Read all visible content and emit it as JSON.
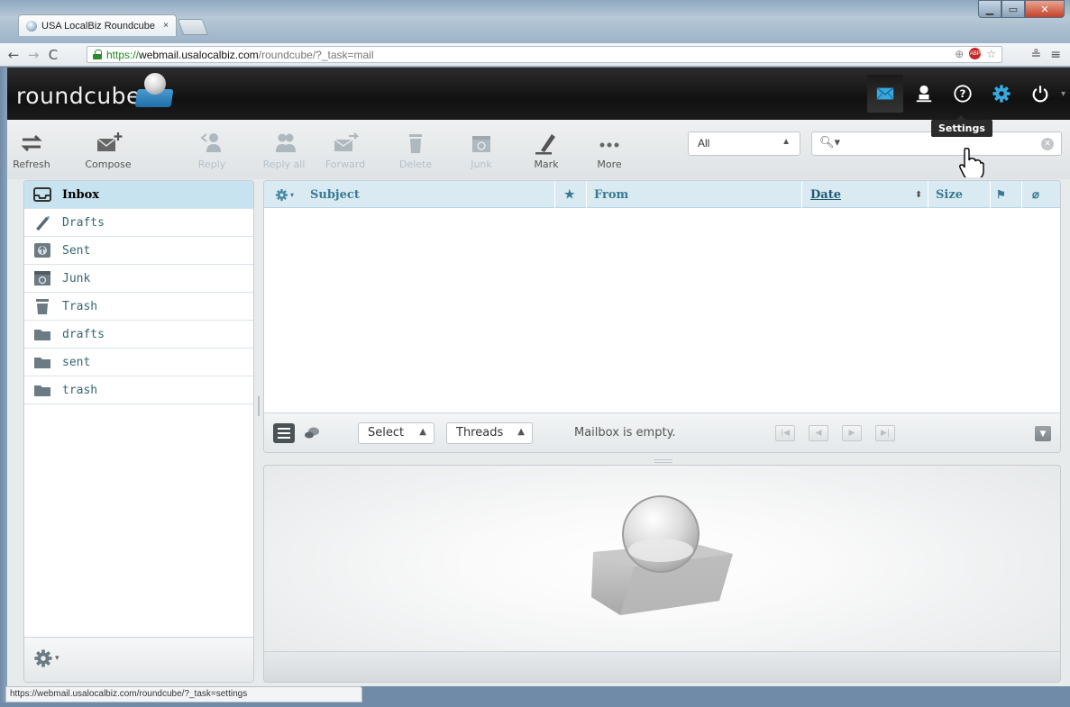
{
  "browser": {
    "tab_title": "USA LocalBiz Roundcube",
    "tab_close": "×",
    "url_scheme": "https://",
    "url_host": "webmail.usalocalbiz.com",
    "url_path": "/roundcube/?_task=mail",
    "status_url": "https://webmail.usalocalbiz.com/roundcube/?_task=settings"
  },
  "header": {
    "logo_text": "roundcube",
    "tooltip": "Settings",
    "nav": [
      {
        "name": "mail",
        "icon": "envelope-icon",
        "active": true
      },
      {
        "name": "contacts",
        "icon": "person-icon"
      },
      {
        "name": "help",
        "icon": "help-icon"
      },
      {
        "name": "settings",
        "icon": "gear-icon"
      },
      {
        "name": "logout",
        "icon": "power-icon"
      }
    ]
  },
  "toolbar": {
    "refresh": "Refresh",
    "compose": "Compose",
    "reply": "Reply",
    "reply_all": "Reply all",
    "forward": "Forward",
    "delete": "Delete",
    "junk": "Junk",
    "mark": "Mark",
    "more": "More",
    "filter_value": "All",
    "search_placeholder": ""
  },
  "folders": [
    {
      "label": "Inbox",
      "icon": "inbox-icon",
      "selected": true
    },
    {
      "label": "Drafts",
      "icon": "pencil-icon"
    },
    {
      "label": "Sent",
      "icon": "sent-icon"
    },
    {
      "label": "Junk",
      "icon": "junk-icon"
    },
    {
      "label": "Trash",
      "icon": "trash-icon"
    },
    {
      "label": "drafts",
      "icon": "folder-icon"
    },
    {
      "label": "sent",
      "icon": "folder-icon"
    },
    {
      "label": "trash",
      "icon": "folder-icon"
    }
  ],
  "list": {
    "columns": {
      "subject": "Subject",
      "from": "From",
      "date": "Date",
      "size": "Size"
    },
    "select_label": "Select",
    "threads_label": "Threads",
    "status": "Mailbox is empty."
  },
  "colors": {
    "accent": "#37a9df",
    "header_bg": "#1b1b1b",
    "selected_folder": "#c7e3ef",
    "list_header": "#d9eaf2"
  }
}
